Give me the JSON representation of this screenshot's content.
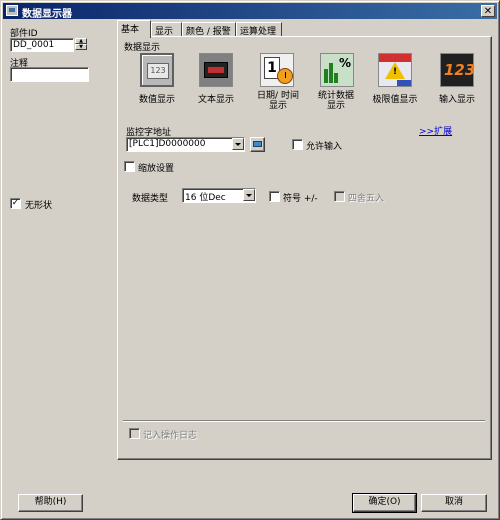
{
  "window": {
    "title": "数据显示器",
    "close_glyph": "✕"
  },
  "left": {
    "part_id_label": "部件ID",
    "part_id_value": "DD_0001",
    "comment_label": "注释",
    "comment_value": "",
    "shapeless_label": "无形状",
    "shapeless_checked": true,
    "help_button": "帮助(H)"
  },
  "tabs": [
    {
      "label": "基本",
      "active": true
    },
    {
      "label": "显示",
      "active": false
    },
    {
      "label": "颜色 / 报警",
      "active": false
    },
    {
      "label": "运算处理",
      "active": false
    }
  ],
  "basic": {
    "section_title": "数据显示",
    "tiles": [
      {
        "caption": "数值显示",
        "icon": "numeric-display-icon",
        "selected": true
      },
      {
        "caption": "文本显示",
        "icon": "text-display-icon",
        "selected": false
      },
      {
        "caption": "日期/ 时间显示",
        "icon": "date-time-display-icon",
        "selected": false
      },
      {
        "caption": "统计数据显示",
        "icon": "statistics-display-icon",
        "selected": false
      },
      {
        "caption": "极限值显示",
        "icon": "limit-display-icon",
        "selected": false
      },
      {
        "caption": "输入显示",
        "icon": "input-display-icon",
        "selected": false
      }
    ],
    "monitor_word_label": "监控字地址",
    "monitor_word_value": "[PLC1]D0000000",
    "allow_input_label": "允许输入",
    "expand_link": ">>扩展",
    "scale_label": "缩放设置",
    "data_type_label": "数据类型",
    "data_type_value": "16 位Dec",
    "sign_label": "符号 +/-",
    "round_label": "四舍五入",
    "log_label": "记入操作日志"
  },
  "footer": {
    "ok_button": "确定(O)",
    "cancel_button": "取消"
  },
  "colors": {
    "title_start": "#0a246a",
    "title_end": "#3a6ea5",
    "link": "#0000cc"
  }
}
